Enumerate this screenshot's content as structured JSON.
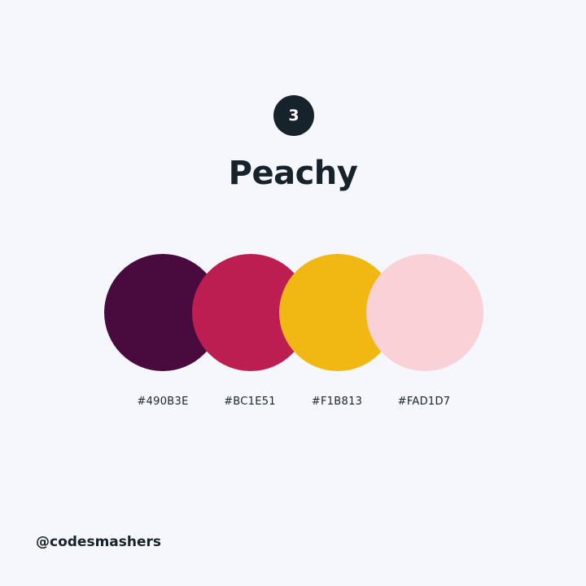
{
  "number": "3",
  "title": "Peachy",
  "colors": [
    {
      "hex": "#490B3E"
    },
    {
      "hex": "#BC1E51"
    },
    {
      "hex": "#F1B813"
    },
    {
      "hex": "#FAD1D7"
    }
  ],
  "handle": "@codesmashers"
}
